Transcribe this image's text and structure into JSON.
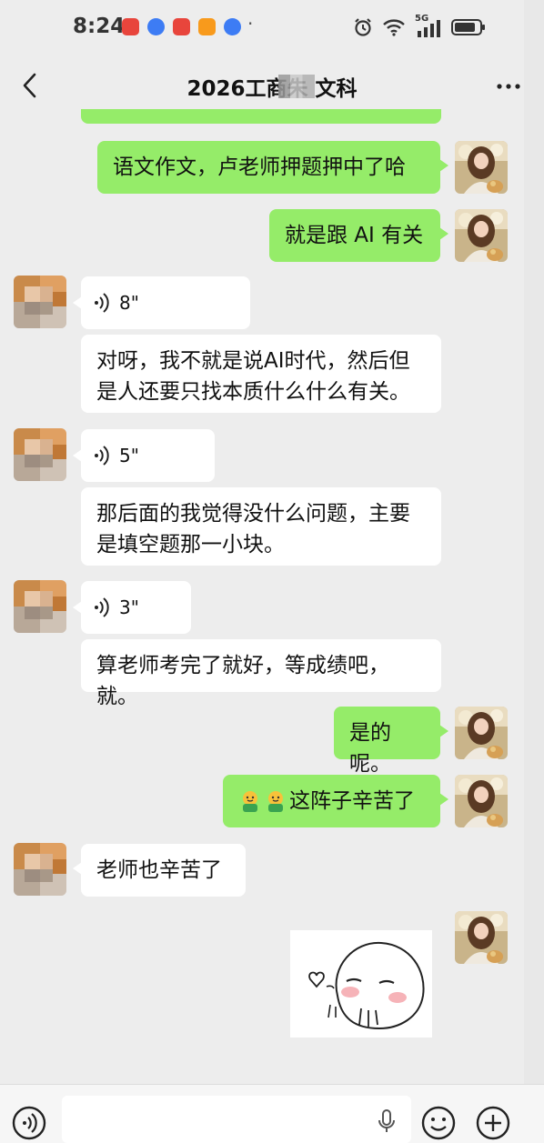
{
  "status_bar": {
    "time": "8:24",
    "network": "5G"
  },
  "header": {
    "title": "2026工商朱    文科"
  },
  "messages": {
    "m1": "语文作文，卢老师押题押中了哈",
    "m2": "就是跟 AI 有关",
    "v1": "8\"",
    "m3_line1": "对呀，我不就是说AI时代，然后但",
    "m3_line2": "是人还要只找本质什么什么有关。",
    "v2": "5\"",
    "m4_line1": "那后面的我觉得没什么问题，主要",
    "m4_line2": "是填空题那一小块。",
    "v3": "3\"",
    "m5": "算老师考完了就好，等成绩吧，就。",
    "m6": "是的呢。",
    "m7": "这阵子辛苦了",
    "m8": "老师也辛苦了"
  },
  "icons": {
    "back": "chevron-left-icon",
    "more": "more-dots-icon",
    "voice": "voice-wave-icon",
    "voice_toggle": "voice-input-icon",
    "mic": "mic-icon",
    "emoji": "emoji-icon",
    "plus": "plus-icon",
    "hug_emoji": "hug-emoji-icon"
  },
  "colors": {
    "my_bubble": "#95ec69",
    "other_bubble": "#ffffff",
    "background": "#ededed"
  }
}
